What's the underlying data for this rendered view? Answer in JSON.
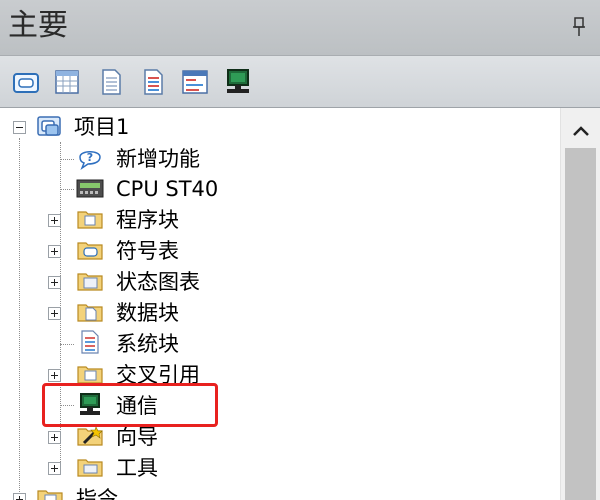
{
  "panel": {
    "title": "主要"
  },
  "toolbar": {
    "buttons": [
      {
        "icon": "symbol-table-icon"
      },
      {
        "icon": "status-chart-icon"
      },
      {
        "icon": "data-block-icon"
      },
      {
        "icon": "system-block-icon"
      },
      {
        "icon": "cross-reference-icon"
      },
      {
        "icon": "communication-icon"
      }
    ]
  },
  "tree": {
    "project": "项目1",
    "items": [
      {
        "label": "新增功能",
        "icon": "help-icon"
      },
      {
        "label": "CPU ST40",
        "icon": "cpu-icon"
      },
      {
        "label": "程序块",
        "icon": "program-block-folder-icon"
      },
      {
        "label": "符号表",
        "icon": "symbol-table-folder-icon"
      },
      {
        "label": "状态图表",
        "icon": "status-chart-folder-icon"
      },
      {
        "label": "数据块",
        "icon": "data-block-folder-icon"
      },
      {
        "label": "系统块",
        "icon": "system-block-icon"
      },
      {
        "label": "交叉引用",
        "icon": "cross-reference-folder-icon"
      },
      {
        "label": "通信",
        "icon": "communication-icon"
      },
      {
        "label": "向导",
        "icon": "wizard-folder-icon"
      },
      {
        "label": "工具",
        "icon": "tools-folder-icon"
      }
    ],
    "next_root": "指令"
  },
  "colors": {
    "highlight": "#e8211f",
    "title_bar": "#c4c7ca",
    "toolbar": "#d6dade"
  }
}
